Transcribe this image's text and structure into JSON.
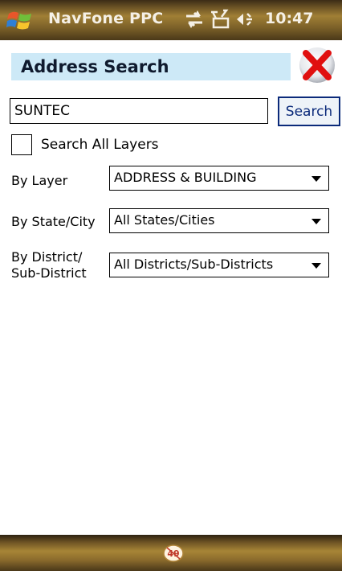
{
  "statusbar": {
    "app_title": "NavFone PPC",
    "time": "10:47",
    "icons": [
      "windows-start-icon",
      "connectivity-icon",
      "signal-off-icon",
      "volume-icon"
    ]
  },
  "header": {
    "title": "Address Search",
    "close_icon": "close-icon"
  },
  "search": {
    "value": "SUNTEC",
    "button_label": "Search"
  },
  "options": {
    "search_all_layers_label": "Search All Layers",
    "search_all_layers_checked": false
  },
  "filters": {
    "layer": {
      "label": "By Layer",
      "value": "ADDRESS & BUILDING"
    },
    "state_city": {
      "label": "By State/City",
      "value": "All States/Cities"
    },
    "district": {
      "label_line1": "By District/",
      "label_line2": "Sub-District",
      "value": "All Districts/Sub-Districts"
    }
  },
  "bottombar": {
    "badge_text": "49",
    "badge_icon": "keyboard-toggle-icon"
  }
}
